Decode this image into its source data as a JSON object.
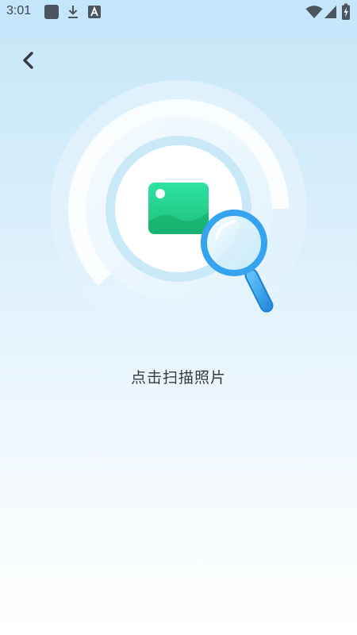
{
  "status_bar": {
    "time": "3:01",
    "left_icons": [
      "app-square-icon",
      "download-icon",
      "keyboard-a-icon"
    ],
    "right_icons": [
      "wifi-icon",
      "signal-icon",
      "battery-icon"
    ]
  },
  "nav": {
    "back_icon": "chevron-left-icon"
  },
  "hero": {
    "icons": [
      "photo-icon",
      "magnifier-icon"
    ],
    "colors": {
      "photo": "#22d18b",
      "magnifier": "#36a3ef",
      "ring": "#c9e9f9"
    }
  },
  "main": {
    "scan_label": "点击扫描照片"
  }
}
